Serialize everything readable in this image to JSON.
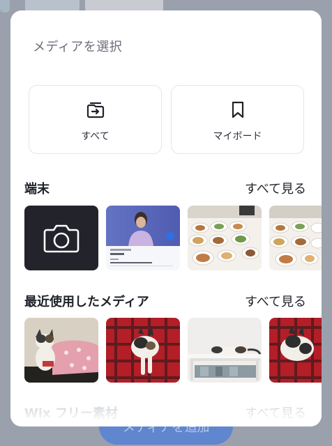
{
  "background": {
    "cta_label": "メディアを追加"
  },
  "sheet": {
    "title": "メディアを選択",
    "sources": [
      {
        "label": "すべて",
        "icon": "folder-arrow-icon"
      },
      {
        "label": "マイボード",
        "icon": "bookmark-icon"
      }
    ],
    "sections": [
      {
        "title": "端末",
        "see_all": "すべて見る",
        "items": [
          "camera-tile",
          "portrait-profile-screenshot",
          "dinner-table-photo",
          "dinner-table-photo"
        ]
      },
      {
        "title": "最近使用したメディア",
        "see_all": "すべて見る",
        "items": [
          "cat-on-pink-blanket",
          "cat-on-red-plaid",
          "cat-under-table",
          "cat-on-red-plaid"
        ]
      },
      {
        "title": "Wix フリー素材",
        "see_all": "すべて見る"
      }
    ],
    "profile_card": {
      "caption": "プロジェクト名",
      "name": "顔写真",
      "date_label": "日付",
      "note": "晴らせるモデルの撮影画像です。"
    }
  },
  "colors": {
    "accent": "#5f86cf",
    "camera_tile": "#23232b",
    "overlay": "#9aa1ad"
  }
}
